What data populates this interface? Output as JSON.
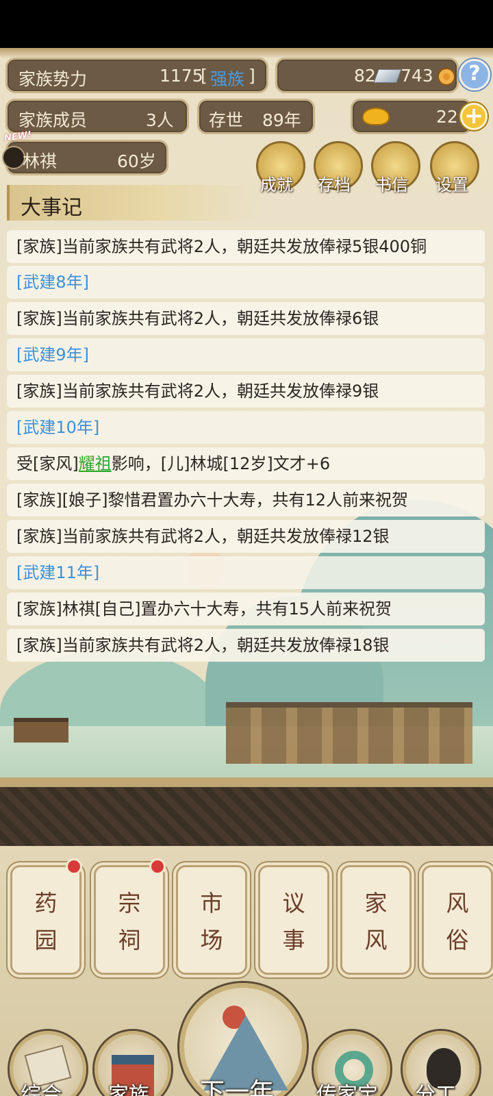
{
  "header": {
    "power_label": "家族势力",
    "power_value": "1175",
    "power_rank": "强族",
    "silver": "82",
    "copper": "743",
    "members_label": "家族成员",
    "members_value": "3人",
    "exist_label": "存世",
    "exist_value": "89年",
    "gold": "22",
    "new_badge": "NEW!",
    "person_name": "林祺",
    "person_age": "60岁"
  },
  "menu": [
    {
      "label": "成就"
    },
    {
      "label": "存档"
    },
    {
      "label": "书信"
    },
    {
      "label": "设置"
    }
  ],
  "log": {
    "title": "大事记",
    "entries": [
      {
        "text": "[家族]当前家族共有武将2人，朝廷共发放俸禄5银400铜"
      },
      {
        "text": "[武建8年]"
      },
      {
        "text": "[家族]当前家族共有武将2人，朝廷共发放俸禄6银"
      },
      {
        "text": "[武建9年]"
      },
      {
        "text": "[家族]当前家族共有武将2人，朝廷共发放俸禄9银"
      },
      {
        "text": "[武建10年]"
      },
      {
        "pre": "受[家风]",
        "hl": "耀祖",
        "post": "影响，[儿]林城[12岁]文才+6"
      },
      {
        "text": "[家族][娘子]黎惜君置办六十大寿，共有12人前来祝贺"
      },
      {
        "text": "[家族]当前家族共有武将2人，朝廷共发放俸禄12银"
      },
      {
        "text": "[武建11年]"
      },
      {
        "text": "[家族]林祺[自己]置办六十大寿，共有15人前来祝贺"
      },
      {
        "text": "[家族]当前家族共有武将2人，朝廷共发放俸禄18银"
      }
    ]
  },
  "cards": [
    {
      "l1": "药",
      "l2": "园"
    },
    {
      "l1": "宗",
      "l2": "祠"
    },
    {
      "l1": "市",
      "l2": "场"
    },
    {
      "l1": "议",
      "l2": "事"
    },
    {
      "l1": "家",
      "l2": "风"
    },
    {
      "l1": "风",
      "l2": "俗"
    }
  ],
  "nav": {
    "overview": "综合",
    "family": "家族",
    "next_year": "下一年",
    "heirloom": "传家宝",
    "division": "分工"
  },
  "colors": {
    "rank": "#3d8fd8",
    "year": "#3d8fd8",
    "highlight": "#2fa52d",
    "badge": "#d83a3a"
  }
}
